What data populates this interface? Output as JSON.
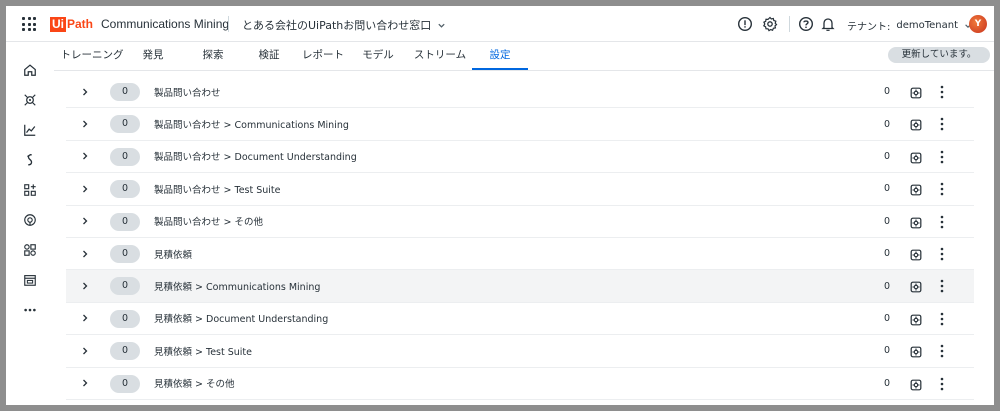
{
  "header": {
    "logo_ui": "Ui",
    "logo_path": "Path",
    "product_name": "Communications Mining",
    "dataset_name": "とある会社のUiPathお問い合わせ窓口",
    "tenant_label": "テナント:",
    "tenant_name": "demoTenant",
    "avatar_initial": "Y",
    "accent_color": "#fa4616"
  },
  "sidebar": {
    "items": [
      "home-icon",
      "train-icon",
      "chart-icon",
      "streams-icon",
      "apps-add-icon",
      "mining-icon",
      "integrations-icon",
      "dataset-icon",
      "more-icon"
    ]
  },
  "tabs": {
    "items": [
      {
        "label": "トレーニング"
      },
      {
        "label": "発見"
      },
      {
        "label": "探索"
      },
      {
        "label": "検証"
      },
      {
        "label": "レポート"
      },
      {
        "label": "モデル"
      },
      {
        "label": "ストリーム"
      },
      {
        "label": "設定"
      }
    ],
    "active_index": 7,
    "status": "更新しています。"
  },
  "labels": {
    "rows": [
      {
        "pill": "0",
        "name": "製品問い合わせ",
        "count": "0"
      },
      {
        "pill": "0",
        "name": "製品問い合わせ > Communications Mining",
        "count": "0"
      },
      {
        "pill": "0",
        "name": "製品問い合わせ > Document Understanding",
        "count": "0"
      },
      {
        "pill": "0",
        "name": "製品問い合わせ > Test Suite",
        "count": "0"
      },
      {
        "pill": "0",
        "name": "製品問い合わせ > その他",
        "count": "0"
      },
      {
        "pill": "0",
        "name": "見積依頼",
        "count": "0"
      },
      {
        "pill": "0",
        "name": "見積依頼 > Communications Mining",
        "count": "0"
      },
      {
        "pill": "0",
        "name": "見積依頼 > Document Understanding",
        "count": "0"
      },
      {
        "pill": "0",
        "name": "見積依頼 > Test Suite",
        "count": "0"
      },
      {
        "pill": "0",
        "name": "見積依頼 > その他",
        "count": "0"
      }
    ],
    "hovered_index": 6,
    "expand_glyph": "›"
  }
}
